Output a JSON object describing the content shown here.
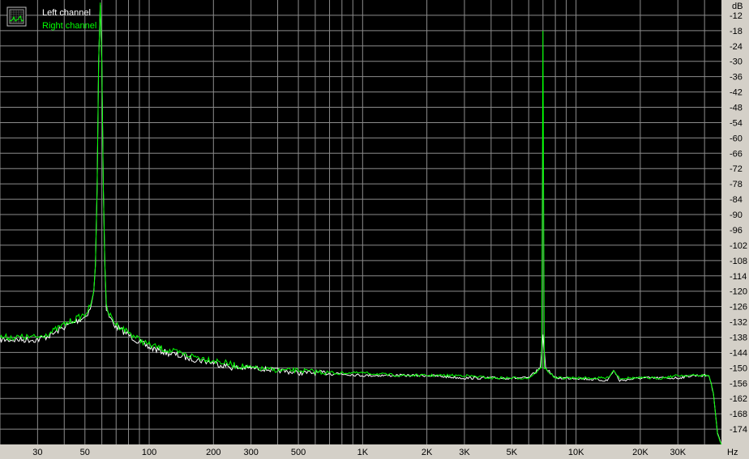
{
  "chart_data": {
    "type": "line",
    "title": "",
    "xlabel": "",
    "ylabel": "",
    "x_unit": "Hz",
    "y_unit": "dB",
    "x_scale": "log",
    "xlim": [
      20,
      48000
    ],
    "ylim": [
      -180,
      -6
    ],
    "grid": true,
    "legend_placement": "top-left",
    "background_color": "#000000",
    "grid_color": "#8c8c8c",
    "x_tick_labels": [
      "30",
      "50",
      "100",
      "200",
      "300",
      "500",
      "1K",
      "2K",
      "3K",
      "5K",
      "10K",
      "20K",
      "30K"
    ],
    "x_tick_values": [
      30,
      50,
      100,
      200,
      300,
      500,
      1000,
      2000,
      3000,
      5000,
      10000,
      20000,
      30000
    ],
    "y_ticks": [
      -12,
      -18,
      -24,
      -30,
      -36,
      -42,
      -48,
      -54,
      -60,
      -66,
      -72,
      -78,
      -84,
      -90,
      -96,
      -102,
      -108,
      -114,
      -120,
      -126,
      -132,
      -138,
      -144,
      -150,
      -156,
      -162,
      -168,
      -174
    ],
    "series": [
      {
        "name": "Left channel",
        "color": "#ffffff",
        "x": [
          20,
          25,
          30,
          35,
          40,
          45,
          50,
          53,
          55,
          56,
          57,
          58,
          59,
          60,
          61,
          62,
          63,
          65,
          70,
          80,
          90,
          100,
          120,
          150,
          200,
          250,
          300,
          400,
          500,
          700,
          1000,
          1500,
          2000,
          3000,
          4000,
          5000,
          6000,
          6800,
          7000,
          7200,
          8000,
          10000,
          14000,
          15000,
          16000,
          20000,
          25000,
          30000,
          35000,
          40000,
          42000,
          44000,
          46000,
          48000
        ],
        "y": [
          -139,
          -139,
          -139,
          -137,
          -134,
          -132,
          -130,
          -127,
          -120,
          -110,
          -80,
          -30,
          -8,
          -30,
          -80,
          -110,
          -127,
          -130,
          -134,
          -137,
          -140,
          -142,
          -144,
          -146,
          -148,
          -150,
          -150,
          -151,
          -152,
          -152,
          -153,
          -153,
          -153,
          -154,
          -154,
          -154,
          -154,
          -150,
          -137,
          -150,
          -154,
          -154,
          -155,
          -151,
          -155,
          -154,
          -154,
          -154,
          -153,
          -153,
          -153,
          -160,
          -175,
          -180
        ]
      },
      {
        "name": "Right channel",
        "color": "#00ff00",
        "x": [
          20,
          25,
          30,
          35,
          40,
          45,
          50,
          53,
          55,
          56,
          57,
          58,
          59,
          60,
          61,
          62,
          63,
          65,
          70,
          80,
          90,
          100,
          120,
          150,
          200,
          250,
          300,
          400,
          500,
          700,
          1000,
          1500,
          2000,
          3000,
          4000,
          5000,
          6000,
          6900,
          7000,
          7100,
          8000,
          10000,
          14000,
          15000,
          16000,
          20000,
          25000,
          30000,
          35000,
          40000,
          42000,
          44000,
          46000,
          48000
        ],
        "y": [
          -138,
          -138,
          -138,
          -136,
          -133,
          -131,
          -129,
          -126,
          -120,
          -110,
          -80,
          -30,
          -7,
          -30,
          -80,
          -110,
          -126,
          -129,
          -133,
          -136,
          -139,
          -141,
          -143,
          -145,
          -147,
          -149,
          -150,
          -151,
          -151,
          -152,
          -152,
          -153,
          -153,
          -153,
          -154,
          -154,
          -154,
          -150,
          -18,
          -150,
          -154,
          -154,
          -154,
          -151,
          -154,
          -154,
          -154,
          -153,
          -153,
          -153,
          -153,
          -160,
          -176,
          -180
        ]
      }
    ]
  }
}
